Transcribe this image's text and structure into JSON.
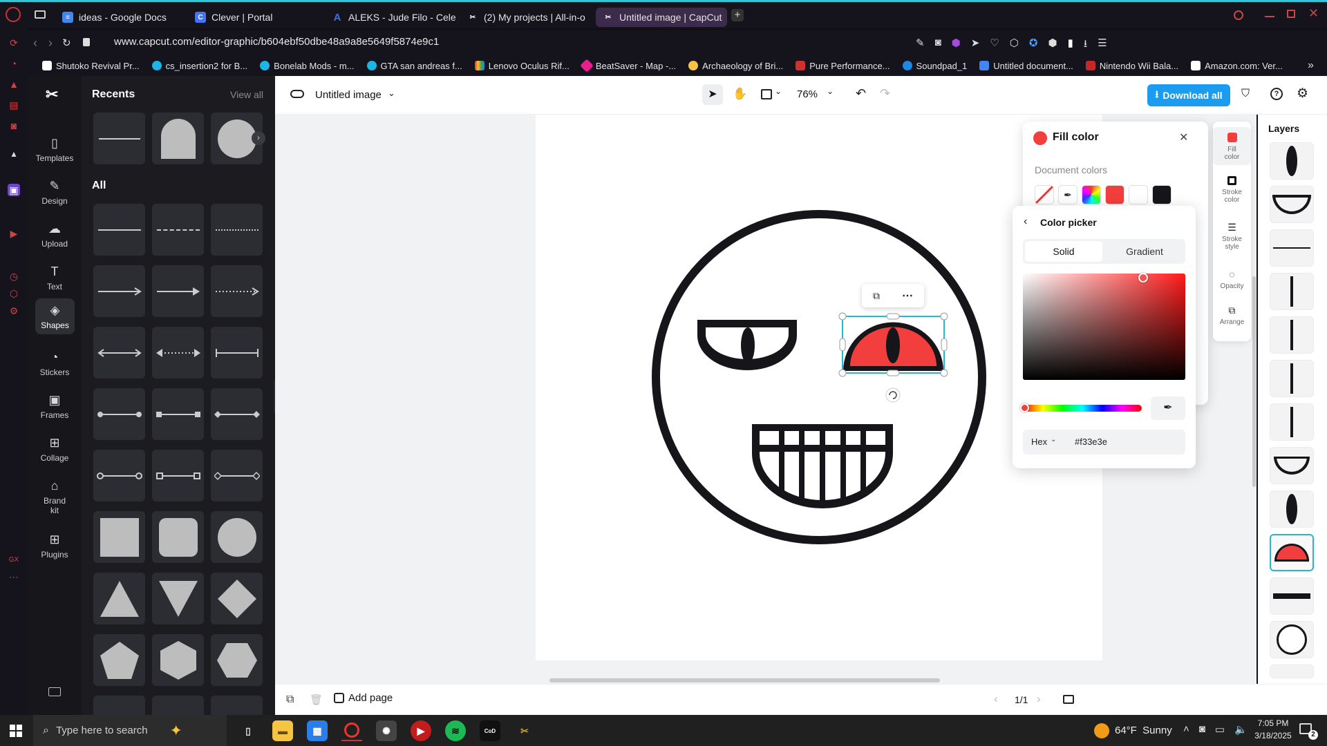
{
  "browser": {
    "tabs": [
      {
        "label": "ideas - Google Docs",
        "icon": "docs-icon",
        "color": "#4285f4"
      },
      {
        "label": "Clever | Portal",
        "icon": "clever-icon",
        "color": "#4573f5"
      },
      {
        "label": "ALEKS - Jude Filo - Celeb",
        "icon": "aleks-icon",
        "color": "#2a5db0"
      },
      {
        "label": "(2) My projects | All-in-o",
        "icon": "capcut-icon",
        "color": "#ffffff"
      },
      {
        "label": "Untitled image | CapCut",
        "icon": "capcut-icon",
        "color": "#ffffff"
      }
    ],
    "new_tab": "+",
    "url": "www.capcut.com/editor-graphic/b604ebf50dbe48a9a8e5649f5874e9c1",
    "bookmarks": [
      {
        "label": "Shutoko Revival Pr...",
        "color": "#ffffff"
      },
      {
        "label": "cs_insertion2 for B...",
        "color": "#1bb6e6"
      },
      {
        "label": "Bonelab Mods - m...",
        "color": "#1bb6e6"
      },
      {
        "label": "GTA san andreas f...",
        "color": "#1bb6e6"
      },
      {
        "label": "Lenovo Oculus Rif...",
        "color": "#f2b418"
      },
      {
        "label": "BeatSaver - Map -...",
        "color": "#e91e8c"
      },
      {
        "label": "Archaeology of Bri...",
        "color": "#f5c542"
      },
      {
        "label": "Pure Performance...",
        "color": "#d32f2f"
      },
      {
        "label": "Soundpad_1",
        "color": "#1e88e5"
      },
      {
        "label": "Untitled document...",
        "color": "#4285f4"
      },
      {
        "label": "Nintendo Wii Bala...",
        "color": "#c62828"
      },
      {
        "label": "Amazon.com: Ver...",
        "color": "#ffffff"
      }
    ]
  },
  "rail": {
    "items": [
      {
        "label": "Templates",
        "icon": "templates-icon"
      },
      {
        "label": "Design",
        "icon": "design-icon"
      },
      {
        "label": "Upload",
        "icon": "upload-icon"
      },
      {
        "label": "Text",
        "icon": "text-icon"
      },
      {
        "label": "Shapes",
        "icon": "shapes-icon"
      },
      {
        "label": "Stickers",
        "icon": "stickers-icon"
      },
      {
        "label": "Frames",
        "icon": "frames-icon"
      },
      {
        "label": "Collage",
        "icon": "collage-icon"
      },
      {
        "label": "Brand kit",
        "icon": "brand-kit-icon"
      },
      {
        "label": "Plugins",
        "icon": "plugins-icon"
      }
    ]
  },
  "panel": {
    "recents_title": "Recents",
    "view_all": "View all",
    "all_title": "All"
  },
  "toolbar": {
    "doc_title": "Untitled image",
    "zoom": "76%",
    "download_label": "Download all"
  },
  "fill": {
    "title": "Fill color",
    "doc_colors_label": "Document colors",
    "swatches": [
      "transparent",
      "eyedropper",
      "rainbow",
      "#f33e3e",
      "#ffffff",
      "#16161a"
    ],
    "picker_title": "Color picker",
    "tab_solid": "Solid",
    "tab_gradient": "Gradient",
    "format": "Hex",
    "hex": "#f33e3e",
    "hue_color": "#f33e3e"
  },
  "props": [
    {
      "label": "Fill color",
      "icon": "fill-color-icon"
    },
    {
      "label": "Stroke color",
      "icon": "stroke-color-icon"
    },
    {
      "label": "Stroke style",
      "icon": "stroke-style-icon"
    },
    {
      "label": "Opacity",
      "icon": "opacity-icon"
    },
    {
      "label": "Arrange",
      "icon": "arrange-icon"
    }
  ],
  "layers": {
    "title": "Layers"
  },
  "bottom": {
    "add_page": "Add page",
    "page_count": "1/1"
  },
  "taskbar": {
    "search_placeholder": "Type here to search",
    "weather": "64°F  Sunny",
    "time": "7:05 PM",
    "date": "3/18/2025",
    "notif_count": "2"
  }
}
